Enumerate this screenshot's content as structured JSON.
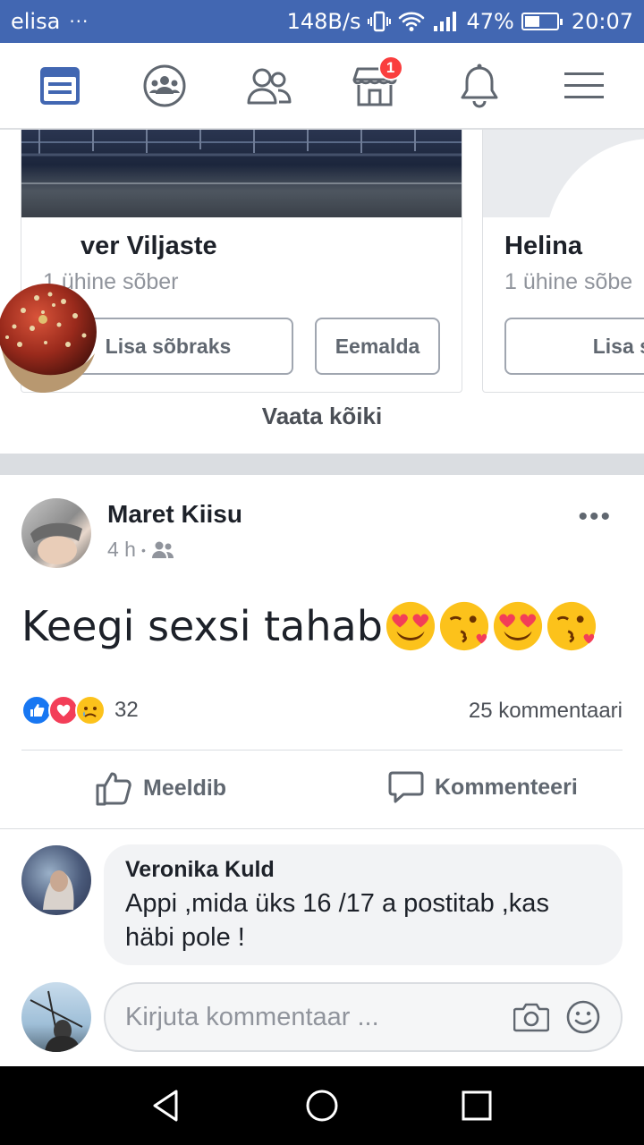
{
  "status_bar": {
    "carrier": "elisa",
    "dots": "···",
    "net_speed": "148B/s",
    "battery_pct": "47%",
    "battery_level": 0.47,
    "time": "20:07"
  },
  "nav": {
    "marketplace_badge": "1"
  },
  "suggestions": {
    "cards": [
      {
        "name": "ver Viljaste",
        "mutual": "1 ühine sõber",
        "add_label": "Lisa sõbraks",
        "remove_label": "Eemalda"
      },
      {
        "name": "Helina",
        "mutual": "1 ühine sõbe",
        "add_label": "Lisa sõ"
      }
    ],
    "see_all": "Vaata kõiki"
  },
  "post": {
    "author": "Maret Kiisu",
    "time": "4 h",
    "meta_dot": "•",
    "more": "•••",
    "text": "Keegi sexsi tahab",
    "reaction_count": "32",
    "comments_count": "25 kommentaari",
    "like_label": "Meeldib",
    "comment_label": "Kommenteeri"
  },
  "comment": {
    "author": "Veronika Kuld",
    "text": "Appi ,mida üks 16 /17 a postitab ,kas häbi pole !"
  },
  "comment_input": {
    "placeholder": "Kirjuta kommentaar ..."
  },
  "colors": {
    "brand": "#4267b2",
    "badge": "#fa3e3e",
    "like": "#1877f2",
    "love": "#f33e58"
  }
}
